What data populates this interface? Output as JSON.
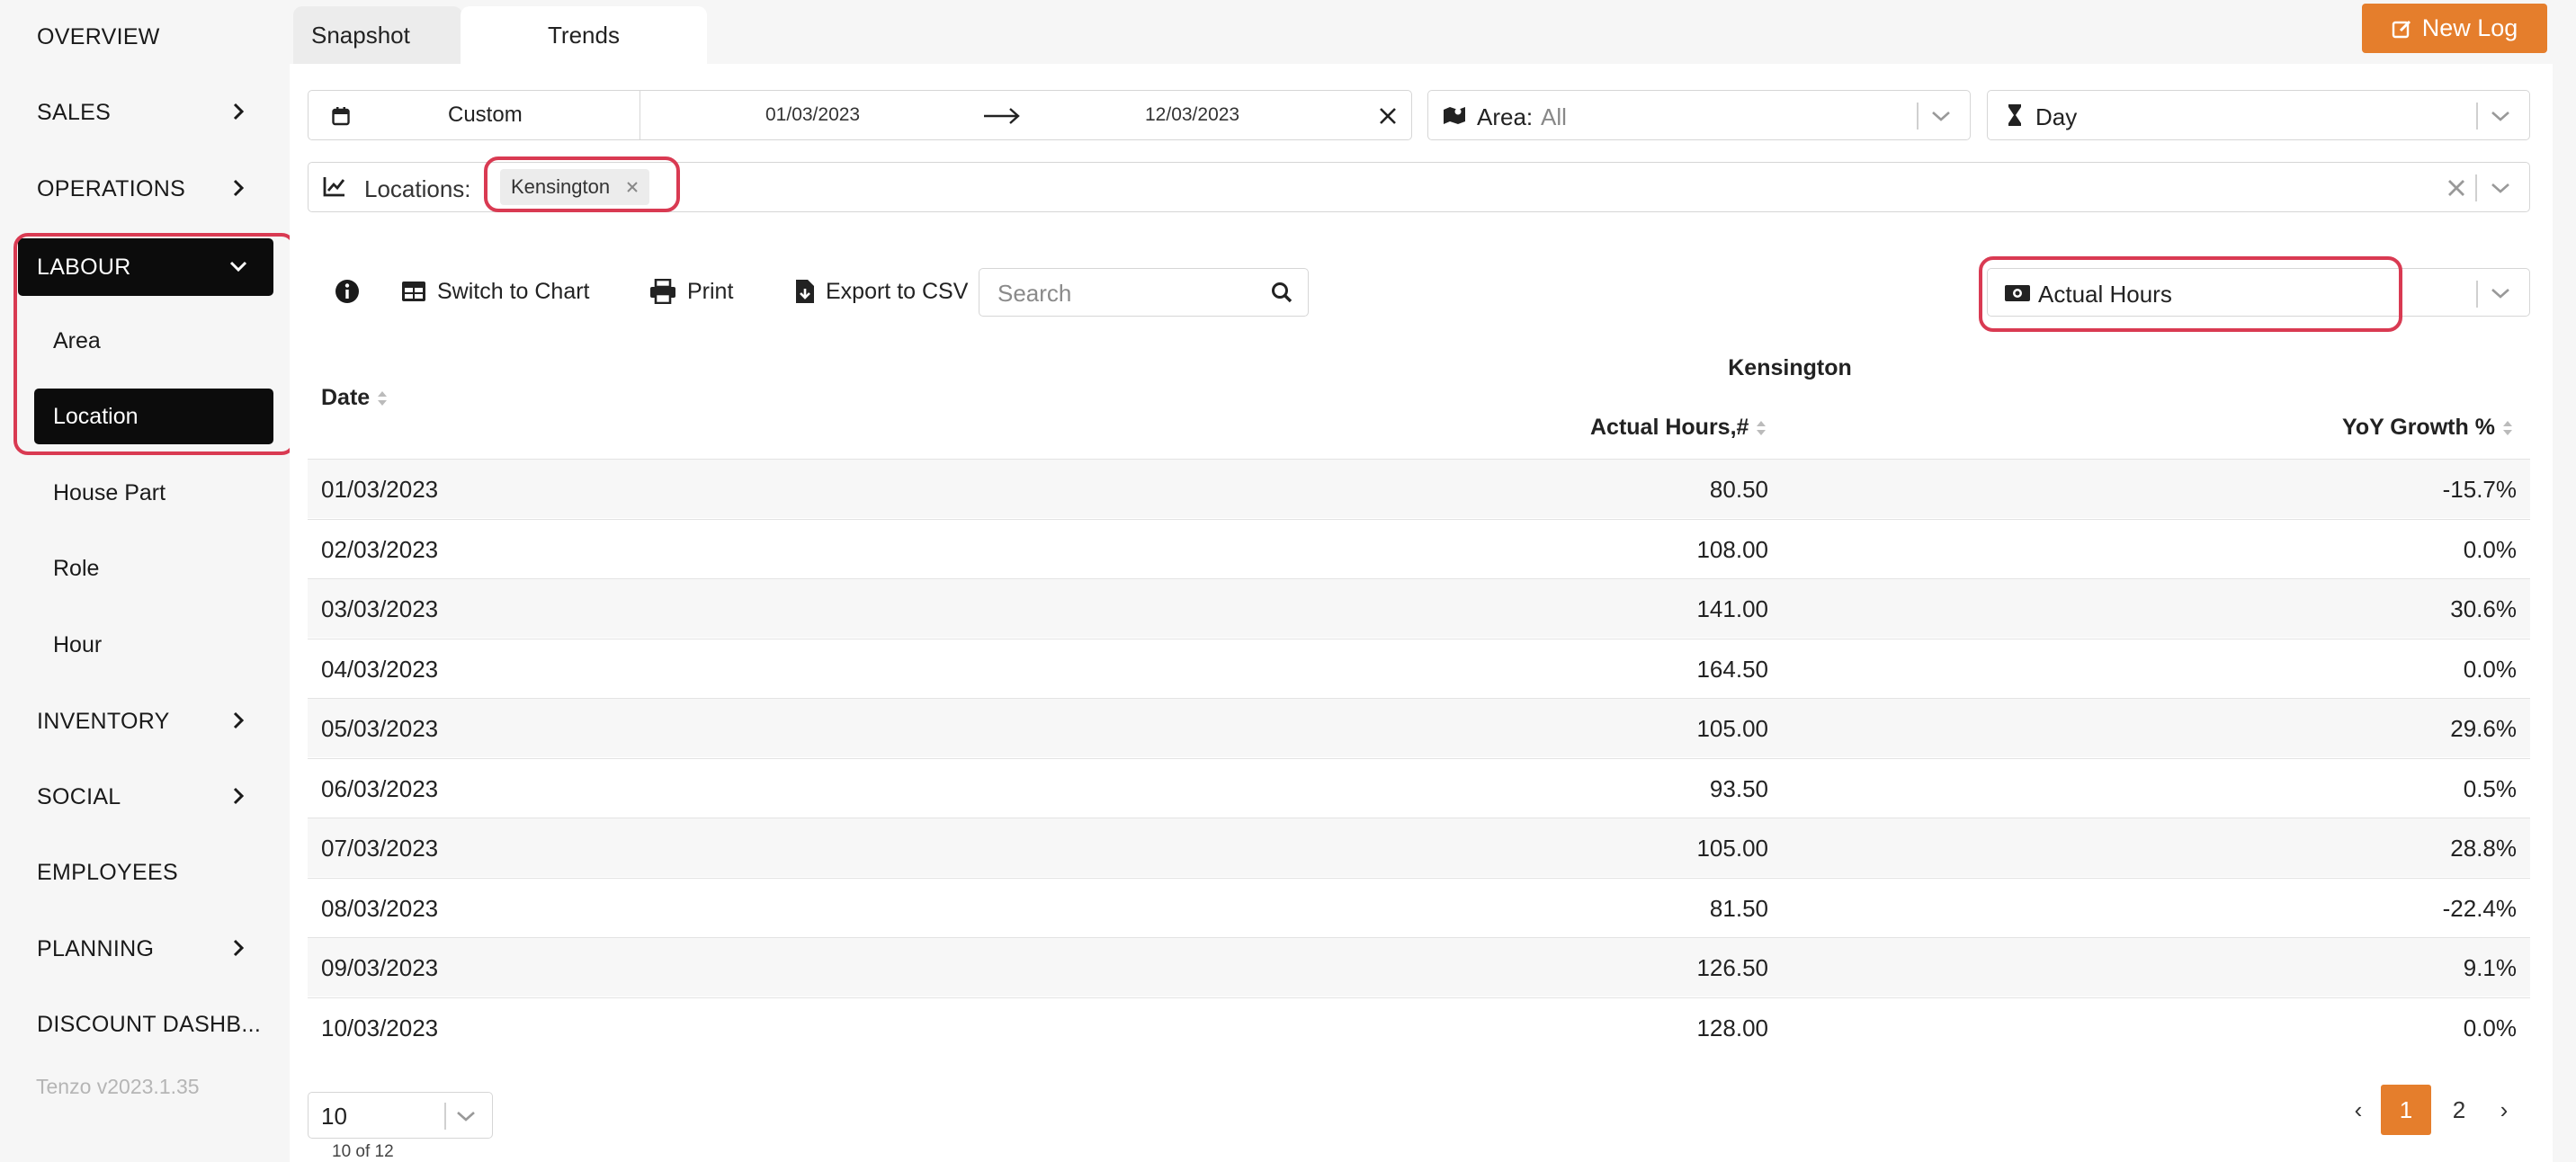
{
  "sidebar": {
    "items": [
      {
        "label": "OVERVIEW"
      },
      {
        "label": "SALES"
      },
      {
        "label": "OPERATIONS"
      },
      {
        "label": "LABOUR"
      },
      {
        "label": "INVENTORY"
      },
      {
        "label": "SOCIAL"
      },
      {
        "label": "EMPLOYEES"
      },
      {
        "label": "PLANNING"
      },
      {
        "label": "DISCOUNT DASHB..."
      }
    ],
    "labour_subitems": [
      {
        "label": "Area"
      },
      {
        "label": "Location"
      },
      {
        "label": "House Part"
      },
      {
        "label": "Role"
      },
      {
        "label": "Hour"
      }
    ],
    "version": "Tenzo v2023.1.35"
  },
  "tabs": [
    {
      "label": "Snapshot"
    },
    {
      "label": "Trends"
    }
  ],
  "new_log_label": "New Log",
  "filters": {
    "range_type": "Custom",
    "date_from": "01/03/2023",
    "date_to": "12/03/2023",
    "area_label": "Area:",
    "area_value": "All",
    "granularity": "Day",
    "locations_label": "Locations:",
    "location_chip": "Kensington"
  },
  "toolbar": {
    "switch_label": "Switch to Chart",
    "print_label": "Print",
    "export_label": "Export to CSV",
    "search_placeholder": "Search",
    "metric_value": "Actual Hours"
  },
  "table": {
    "group_header": "Kensington",
    "columns": [
      "Date",
      "Actual Hours,#",
      "YoY Growth %"
    ],
    "rows": [
      {
        "date": "01/03/2023",
        "hours": "80.50",
        "yoy": "-15.7%"
      },
      {
        "date": "02/03/2023",
        "hours": "108.00",
        "yoy": "0.0%"
      },
      {
        "date": "03/03/2023",
        "hours": "141.00",
        "yoy": "30.6%"
      },
      {
        "date": "04/03/2023",
        "hours": "164.50",
        "yoy": "0.0%"
      },
      {
        "date": "05/03/2023",
        "hours": "105.00",
        "yoy": "29.6%"
      },
      {
        "date": "06/03/2023",
        "hours": "93.50",
        "yoy": "0.5%"
      },
      {
        "date": "07/03/2023",
        "hours": "105.00",
        "yoy": "28.8%"
      },
      {
        "date": "08/03/2023",
        "hours": "81.50",
        "yoy": "-22.4%"
      },
      {
        "date": "09/03/2023",
        "hours": "126.50",
        "yoy": "9.1%"
      },
      {
        "date": "10/03/2023",
        "hours": "128.00",
        "yoy": "0.0%"
      }
    ]
  },
  "pagination": {
    "page_size": "10",
    "count_text": "10 of 12",
    "prev": "‹",
    "next": "›",
    "pages": [
      "1",
      "2"
    ],
    "current_page": "1"
  },
  "colors": {
    "accent": "#e57e2c",
    "highlight": "#d93a52",
    "active_nav": "#0c0c0c"
  }
}
